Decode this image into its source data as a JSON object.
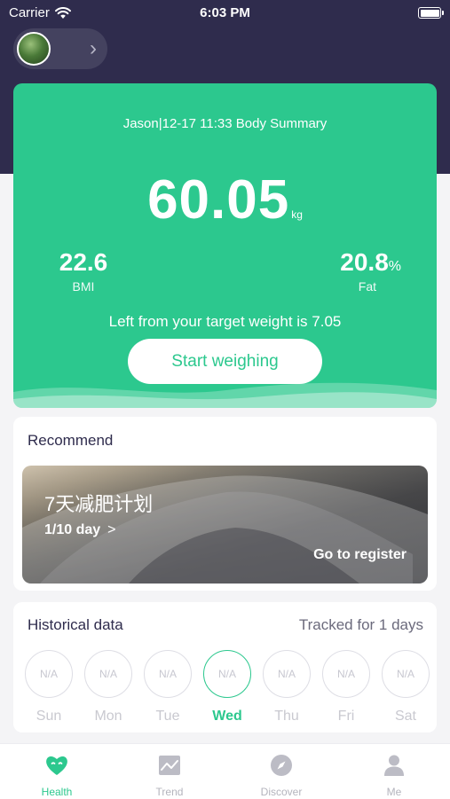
{
  "status_bar": {
    "carrier": "Carrier",
    "time": "6:03 PM",
    "icons": [
      "wifi-icon",
      "battery-icon"
    ]
  },
  "user": {
    "avatar": "avatar",
    "chevron": "›"
  },
  "summary": {
    "title": "Jason|12-17 11:33 Body Summary",
    "weight": "60.05",
    "weight_unit": "kg",
    "bmi_value": "22.6",
    "bmi_label": "BMI",
    "fat_value": "20.8",
    "fat_unit": "%",
    "fat_label": "Fat",
    "target_text": "Left from your target weight is 7.05",
    "start_button": "Start weighing",
    "background_color": "#2cc88e"
  },
  "recommend": {
    "title": "Recommend",
    "banner": {
      "title": "7天减肥计划",
      "progress": "1/10 day",
      "chevron": ">",
      "register_label": "Go to register"
    }
  },
  "history": {
    "title": "Historical data",
    "tracked": "Tracked for 1 days",
    "days": [
      {
        "label": "Sun",
        "value": "N/A",
        "active": false
      },
      {
        "label": "Mon",
        "value": "N/A",
        "active": false
      },
      {
        "label": "Tue",
        "value": "N/A",
        "active": false
      },
      {
        "label": "Wed",
        "value": "N/A",
        "active": true
      },
      {
        "label": "Thu",
        "value": "N/A",
        "active": false
      },
      {
        "label": "Fri",
        "value": "N/A",
        "active": false
      },
      {
        "label": "Sat",
        "value": "N/A",
        "active": false
      }
    ]
  },
  "tabs": [
    {
      "label": "Health",
      "icon": "heart-icon",
      "active": true
    },
    {
      "label": "Trend",
      "icon": "trend-icon",
      "active": false
    },
    {
      "label": "Discover",
      "icon": "compass-icon",
      "active": false
    },
    {
      "label": "Me",
      "icon": "person-icon",
      "active": false
    }
  ],
  "colors": {
    "accent": "#2cc88e",
    "header": "#2f2c4d",
    "inactive": "#b4b4bd"
  }
}
